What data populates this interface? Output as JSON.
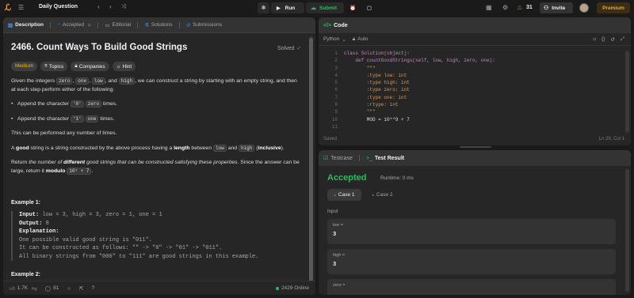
{
  "topbar": {
    "title": "Daily Question",
    "run_label": "Run",
    "submit_label": "Submit",
    "streak": "31",
    "invite_label": "Invite",
    "premium_label": "Premium"
  },
  "left_tabs": [
    "Description",
    "Accepted",
    "Editorial",
    "Solutions",
    "Submissions"
  ],
  "problem": {
    "title": "2466. Count Ways To Build Good Strings",
    "status": "Solved",
    "difficulty": "Medium",
    "tags": [
      "Topics",
      "Companies",
      "Hint"
    ],
    "p1a": "Given the integers ",
    "p1_codes": [
      "zero",
      "one",
      "low",
      "high"
    ],
    "p1b": ", we can construct a string by starting with an empty string, and then at each step perform either of the following:",
    "bullet1a": "Append the character ",
    "bullet1_code1": "'0'",
    "bullet1_code2": "zero",
    "bullet1b": " times.",
    "bullet2a": "Append the character ",
    "bullet2_code1": "'1'",
    "bullet2_code2": "one",
    "bullet2b": " times.",
    "p2": "This can be performed any number of times.",
    "p3a": "A ",
    "p3_good": "good",
    "p3b": " string is a string constructed by the above process having a ",
    "p3_length": "length",
    "p3c": " between ",
    "p3_low": "low",
    "p3d": " and ",
    "p3_high": "high",
    "p3e": " (",
    "p3_inclusive": "inclusive",
    "p3f": ").",
    "p4a": "Return ",
    "p4_em1": "the number of ",
    "p4_diff": "different",
    "p4_em2": " good strings that can be constructed satisfying these properties",
    "p4b": ". Since the answer can be large, return it ",
    "p4_modulo": "modulo",
    "p4_code": "10⁹ + 7",
    "p4c": ".",
    "example1_title": "Example 1:",
    "ex_input_label": "Input:",
    "ex_input": " low = 3, high = 3, zero = 1, one = 1",
    "ex_output_label": "Output:",
    "ex_output": " 8",
    "ex_expl_label": "Explanation:",
    "ex_line1": "One possible valid good string is \"011\".",
    "ex_line2": "It can be constructed as follows: \"\" -> \"0\" -> \"01\" -> \"011\".",
    "ex_line3": "All binary strings from \"000\" to \"111\" are good strings in this example.",
    "example2_title": "Example 2:"
  },
  "footer": {
    "likes": "1.7K",
    "comments": "81",
    "online": "2429 Online"
  },
  "code_panel": {
    "title": "Code",
    "language": "Python",
    "auto": "Auto",
    "saved": "Saved",
    "cursor": "Ln 29, Col 1",
    "lines": [
      {
        "n": "1",
        "t": "class Solution(object):"
      },
      {
        "n": "2",
        "t": "    def countGoodStrings(self, low, high, zero, one):"
      },
      {
        "n": "3",
        "t": "        \"\"\""
      },
      {
        "n": "4",
        "t": "        :type low: int"
      },
      {
        "n": "5",
        "t": "        :type high: int"
      },
      {
        "n": "6",
        "t": "        :type zero: int"
      },
      {
        "n": "7",
        "t": "        :type one: int"
      },
      {
        "n": "8",
        "t": "        :rtype: int"
      },
      {
        "n": "9",
        "t": "        \"\"\""
      },
      {
        "n": "10",
        "t": "        MOD = 10**9 + 7"
      },
      {
        "n": "11",
        "t": ""
      }
    ]
  },
  "test_panel": {
    "tab_testcase": "Testcase",
    "tab_result": "Test Result",
    "status": "Accepted",
    "runtime": "Runtime: 0 ms",
    "case1": "Case 1",
    "case2": "Case 2",
    "input_label": "Input",
    "vars": [
      {
        "name": "low =",
        "value": "3"
      },
      {
        "name": "high =",
        "value": "3"
      },
      {
        "name": "zero =",
        "value": ""
      }
    ]
  },
  "colors": {
    "accent": "#ffa116",
    "green": "#2cbb5d",
    "medium": "#ffb800"
  }
}
